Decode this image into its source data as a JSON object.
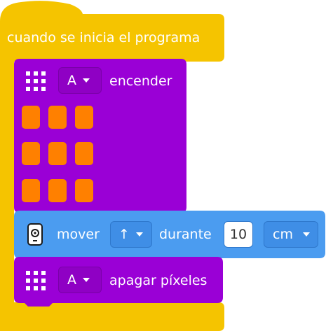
{
  "colors": {
    "event_block": "#f5c400",
    "light_block": "#9a00d6",
    "motion_block": "#4b9cf0",
    "pixel_on": "#ff8000"
  },
  "event_block": {
    "label": "cuando se inicia el programa"
  },
  "light_on_block": {
    "icon": "light-matrix-icon",
    "port": "A",
    "label": "encender",
    "pixels_lit": 9
  },
  "move_block": {
    "icon": "motion-sensor-icon",
    "label_move": "mover",
    "direction": "↑",
    "label_duration": "durante",
    "amount": "10",
    "unit": "cm"
  },
  "light_off_block": {
    "icon": "light-matrix-icon",
    "port": "A",
    "label": "apagar píxeles"
  }
}
